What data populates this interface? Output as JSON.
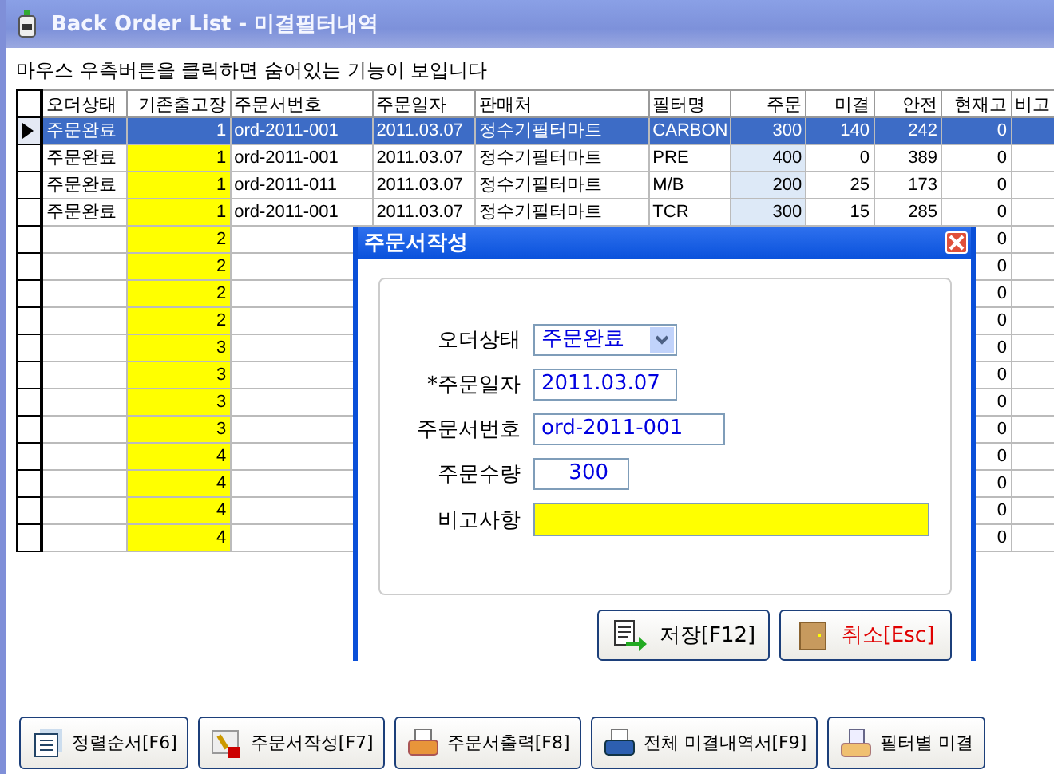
{
  "window": {
    "title": "Back Order List - 미결필터내역"
  },
  "hint": "마우스 우측버튼을 클릭하면 숨어있는 기능이 보입니다",
  "table": {
    "columns": [
      "오더상태",
      "기존출고장",
      "주문서번호",
      "주문일자",
      "판매처",
      "필터명",
      "주문",
      "미결",
      "안전",
      "현재고",
      "비고"
    ],
    "rows": [
      {
        "selected": true,
        "cells": [
          "주문완료",
          "1",
          "ord-2011-001",
          "2011.03.07",
          "정수기필터마트",
          "CARBON",
          "300",
          "140",
          "242",
          "0",
          ""
        ]
      },
      {
        "selected": false,
        "cells": [
          "주문완료",
          "1",
          "ord-2011-001",
          "2011.03.07",
          "정수기필터마트",
          "PRE",
          "400",
          "0",
          "389",
          "0",
          ""
        ]
      },
      {
        "selected": false,
        "cells": [
          "주문완료",
          "1",
          "ord-2011-011",
          "2011.03.07",
          "정수기필터마트",
          "M/B",
          "200",
          "25",
          "173",
          "0",
          ""
        ]
      },
      {
        "selected": false,
        "cells": [
          "주문완료",
          "1",
          "ord-2011-001",
          "2011.03.07",
          "정수기필터마트",
          "TCR",
          "300",
          "15",
          "285",
          "0",
          ""
        ]
      },
      {
        "selected": false,
        "cells": [
          "",
          "2",
          "",
          "",
          "",
          "",
          "",
          "",
          "",
          "0",
          ""
        ]
      },
      {
        "selected": false,
        "cells": [
          "",
          "2",
          "",
          "",
          "",
          "",
          "",
          "",
          "",
          "0",
          ""
        ]
      },
      {
        "selected": false,
        "cells": [
          "",
          "2",
          "",
          "",
          "",
          "",
          "",
          "",
          "",
          "0",
          ""
        ]
      },
      {
        "selected": false,
        "cells": [
          "",
          "2",
          "",
          "",
          "",
          "",
          "",
          "",
          "",
          "0",
          ""
        ]
      },
      {
        "selected": false,
        "cells": [
          "",
          "3",
          "",
          "",
          "",
          "",
          "",
          "",
          "",
          "0",
          ""
        ]
      },
      {
        "selected": false,
        "cells": [
          "",
          "3",
          "",
          "",
          "",
          "",
          "",
          "",
          "",
          "0",
          ""
        ]
      },
      {
        "selected": false,
        "cells": [
          "",
          "3",
          "",
          "",
          "",
          "",
          "",
          "",
          "",
          "0",
          ""
        ]
      },
      {
        "selected": false,
        "cells": [
          "",
          "3",
          "",
          "",
          "",
          "",
          "",
          "",
          "",
          "0",
          ""
        ]
      },
      {
        "selected": false,
        "cells": [
          "",
          "4",
          "",
          "",
          "",
          "",
          "",
          "",
          "",
          "0",
          ""
        ]
      },
      {
        "selected": false,
        "cells": [
          "",
          "4",
          "",
          "",
          "",
          "",
          "",
          "",
          "",
          "0",
          ""
        ]
      },
      {
        "selected": false,
        "cells": [
          "",
          "4",
          "",
          "",
          "",
          "",
          "",
          "",
          "",
          "0",
          ""
        ]
      },
      {
        "selected": false,
        "cells": [
          "",
          "4",
          "",
          "",
          "",
          "",
          "",
          "",
          "",
          "0",
          ""
        ]
      }
    ]
  },
  "dialog": {
    "title": "주문서작성",
    "fields": [
      {
        "kind": "dropdown",
        "label": "오더상태",
        "value": "주문완료"
      },
      {
        "kind": "text",
        "label": "*주문일자",
        "value": "2011.03.07"
      },
      {
        "kind": "text",
        "label": "주문서번호",
        "value": "ord-2011-001"
      },
      {
        "kind": "number",
        "label": "주문수량",
        "value": "300"
      },
      {
        "kind": "memo",
        "label": "비고사항"
      }
    ],
    "buttons": [
      {
        "kind": "save",
        "label": "저장[F12]"
      },
      {
        "kind": "cancel",
        "label": "취소[Esc]"
      }
    ]
  },
  "toolbar": [
    {
      "kind": "sort",
      "label": "정렬순서[F6]"
    },
    {
      "kind": "write",
      "label": "주문서작성[F7]"
    },
    {
      "kind": "print",
      "label": "주문서출력[F8]"
    },
    {
      "kind": "printall",
      "label": "전체 미결내역서[F9]"
    },
    {
      "kind": "doc",
      "label": "필터별 미결"
    }
  ]
}
